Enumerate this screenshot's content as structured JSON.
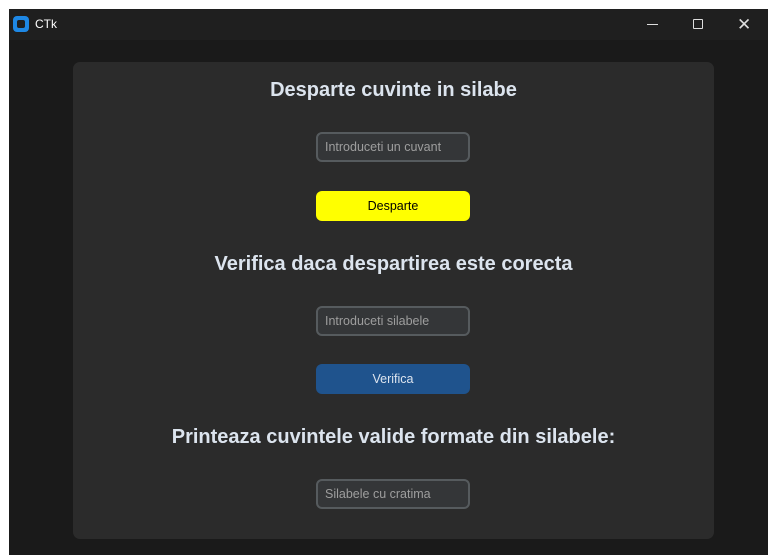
{
  "window": {
    "title": "CTk",
    "controls": {
      "minimize": "minimize-icon",
      "maximize": "maximize-icon",
      "close": "close-icon"
    }
  },
  "section1": {
    "heading": "Desparte cuvinte in silabe",
    "input_placeholder": "Introduceti un cuvant",
    "button_label": "Desparte",
    "button_color": "#ffff00"
  },
  "section2": {
    "heading": "Verifica daca despartirea este corecta",
    "input_placeholder": "Introduceti silabele",
    "button_label": "Verifica",
    "button_color": "#1f538d"
  },
  "section3": {
    "heading": "Printeaza cuvintele valide formate din silabele:",
    "input_placeholder": "Silabele cu cratima"
  }
}
